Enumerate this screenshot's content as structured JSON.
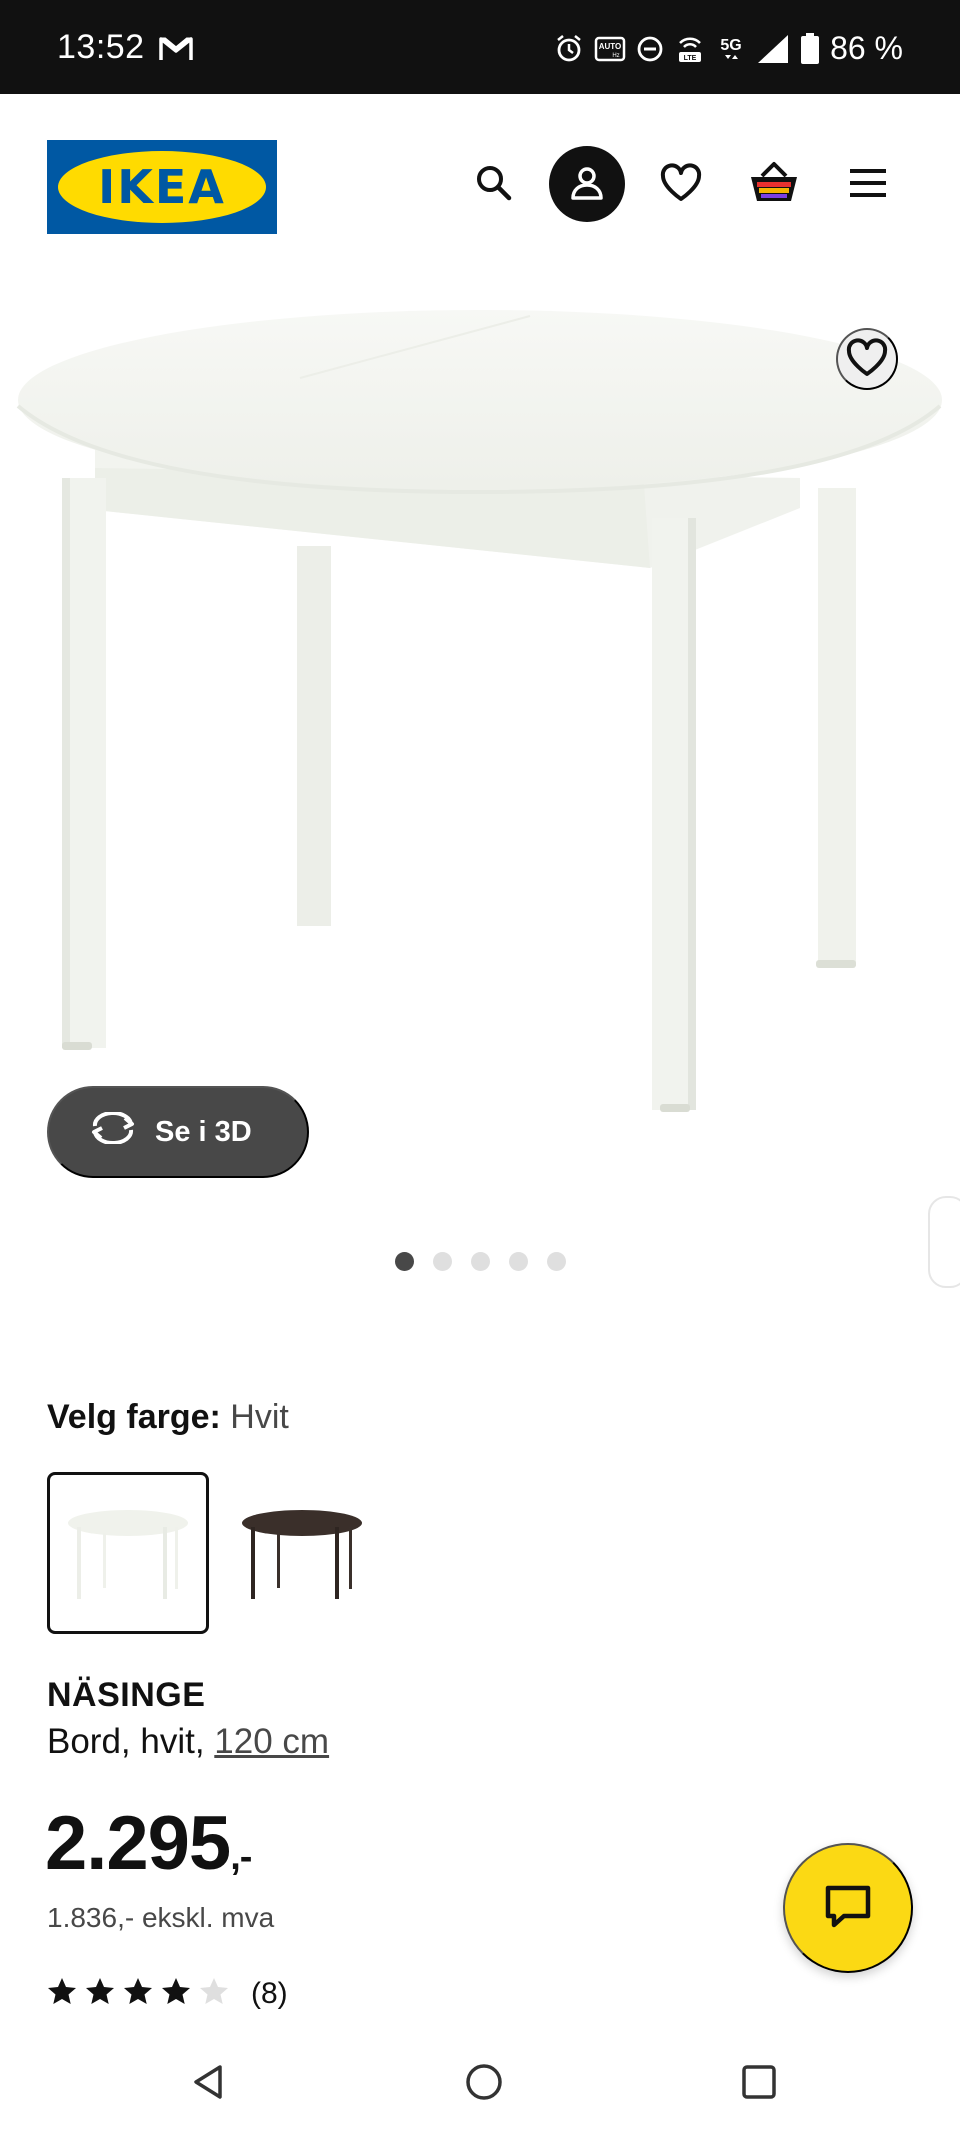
{
  "status_bar": {
    "time": "13:52",
    "left_icon": "gmail-icon",
    "icons": [
      "alarm-icon",
      "auto-hz-icon",
      "dnd-icon",
      "volte-icon",
      "5g-icon",
      "signal-icon",
      "battery-icon"
    ],
    "auto_label": "AUTO",
    "hz_label": "Hz",
    "volte_label": "LTE",
    "network": "5G",
    "battery": "86 %"
  },
  "header": {
    "logo_text": "IKEA",
    "colors": {
      "logo_blue": "#0058a3",
      "logo_yellow": "#ffdb00"
    },
    "icons": [
      "search-icon",
      "account-icon",
      "heart-icon",
      "basket-icon",
      "menu-icon"
    ]
  },
  "gallery": {
    "image": "table-white",
    "view_3d_label": "Se i 3D",
    "dots_count": 5,
    "active_dot": 1
  },
  "color_picker": {
    "label": "Velg farge:",
    "selected": "Hvit",
    "options": [
      "white-table-swatch",
      "dark-brown-table-swatch"
    ]
  },
  "product": {
    "name": "NÄSINGE",
    "description_prefix": "Bord, hvit, ",
    "size_link": "120 cm",
    "price_main": "2.295",
    "price_suffix": ",-",
    "price_ex_vat": "1.836,- ekskl. mva",
    "rating": {
      "stars": 4,
      "max": 5,
      "count": "(8)"
    }
  },
  "chat": {
    "icon": "chat-icon",
    "color": "#fbd914"
  },
  "nav": {
    "icons": [
      "back-icon",
      "home-icon",
      "recents-icon"
    ]
  }
}
